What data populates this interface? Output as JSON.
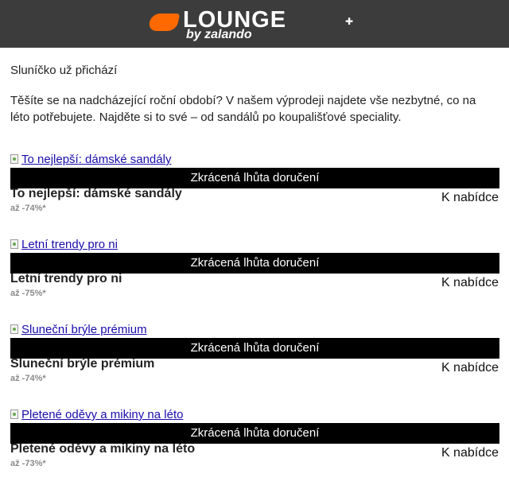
{
  "header": {
    "logo_word": "LOUNGE",
    "logo_sub": "by zalando",
    "logo_flag": "✚",
    "background": "#3c3c3c",
    "accent": "#ff6900"
  },
  "greeting": "Sluníčko už přichází",
  "intro": "Těšíte se na nadcházející roční období? V našem výprodeji najdete vše nezbytné, co na léto potřebujete. Najděte si to své – od sandálů po koupališťové speciality.",
  "offers": [
    {
      "image_alt": "To nejlepší: dámské sandály",
      "delivery": "Zkrácená lhůta doručení",
      "title": "To nejlepší: dámské sandály",
      "discount": "až -74%*",
      "cta": "K nabídce"
    },
    {
      "image_alt": "Letní trendy pro ni",
      "delivery": "Zkrácená lhůta doručení",
      "title": "Letní trendy pro ni",
      "discount": "až -75%*",
      "cta": "K nabídce"
    },
    {
      "image_alt": "Sluneční brýle prémium",
      "delivery": "Zkrácená lhůta doručení",
      "title": "Sluneční brýle prémium",
      "discount": "až -74%*",
      "cta": "K nabídce"
    },
    {
      "image_alt": "Pletené oděvy a mikiny na léto",
      "delivery": "Zkrácená lhůta doručení",
      "title": "Pletené oděvy a mikiny na léto",
      "discount": "až -73%*",
      "cta": "K nabídce"
    }
  ]
}
